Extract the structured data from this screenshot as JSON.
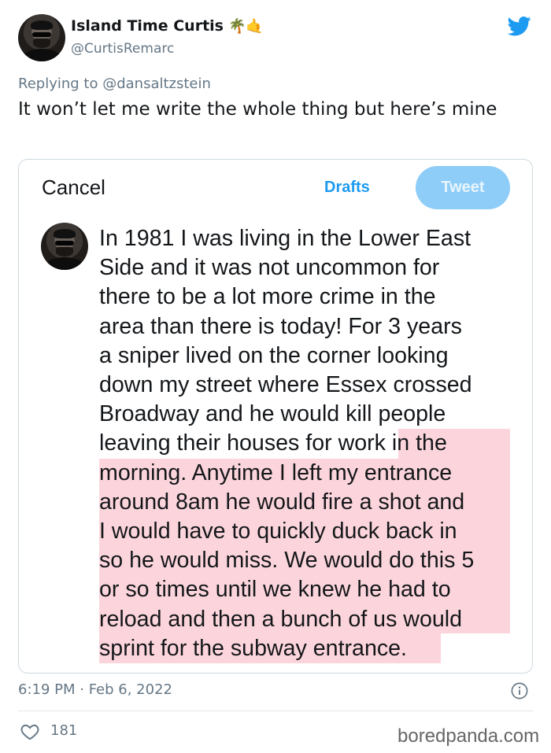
{
  "author": {
    "name": "Island Time Curtis",
    "emojis": "🌴🤙",
    "handle": "@CurtisRemarc"
  },
  "reply": {
    "prefix": "Replying to",
    "mention": "@dansaltzstein"
  },
  "tweet_text": "It won’t let me write the whole thing but here’s mine",
  "embedded_screenshot": {
    "cancel_label": "Cancel",
    "drafts_label": "Drafts",
    "tweet_button_label": "Tweet",
    "highlight_color": "#fcd5dc",
    "draft_lines": [
      "In 1981 I was living in the Lower East",
      "Side and it was not uncommon for",
      "there to be a lot more crime in the",
      "area than there is today! For 3 years",
      "a sniper lived on the corner looking",
      "down my street where Essex crossed",
      "Broadway and he would kill people",
      "leaving their houses for work in the",
      "morning. Anytime I left my entrance",
      "around 8am he would fire a shot and",
      "I would have to quickly duck back in",
      "so he would miss. We would do this 5",
      "or so times until we knew he had to",
      "reload and then a bunch of us would",
      "sprint for the subway entrance."
    ]
  },
  "timestamp": "6:19 PM · Feb 6, 2022",
  "likes_count": "181",
  "watermark": "boredpanda.com",
  "icons": [
    "twitter-bird-icon",
    "info-icon",
    "heart-icon"
  ],
  "colors": {
    "twitter_blue": "#1d9bf0",
    "secondary_text": "#657786"
  }
}
